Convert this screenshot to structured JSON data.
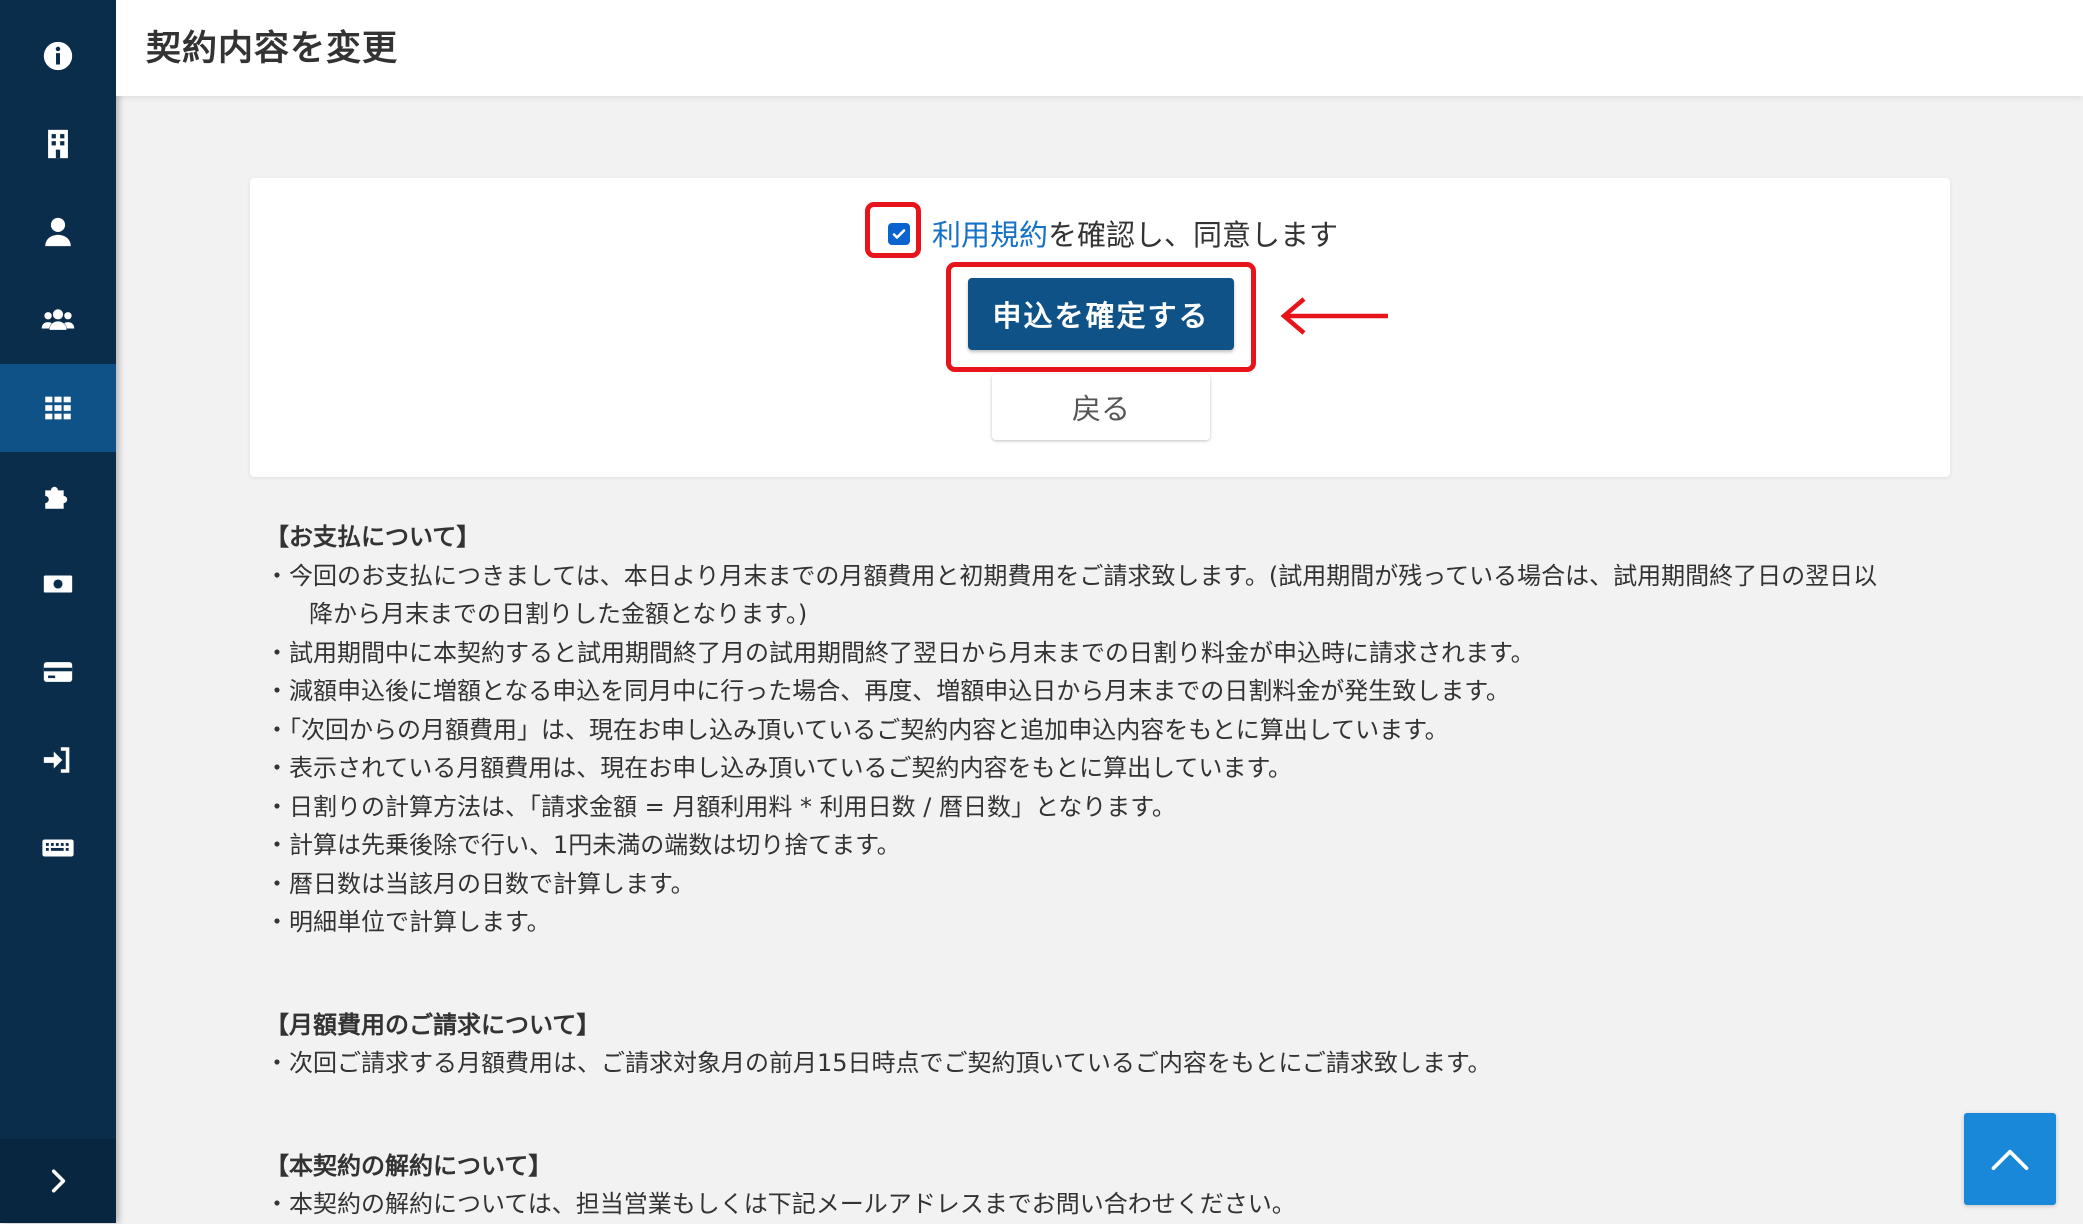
{
  "page": {
    "title": "契約内容を変更"
  },
  "sidebar": {
    "items": [
      {
        "icon": "info-icon"
      },
      {
        "icon": "building-icon"
      },
      {
        "icon": "user-icon"
      },
      {
        "icon": "users-icon"
      },
      {
        "icon": "grid-icon",
        "active": true
      },
      {
        "icon": "puzzle-icon"
      },
      {
        "icon": "money-icon"
      },
      {
        "icon": "credit-card-icon"
      },
      {
        "icon": "sign-in-icon"
      },
      {
        "icon": "keyboard-icon"
      }
    ],
    "toggle_icon": "chevron-right-icon"
  },
  "agreement": {
    "checked": true,
    "terms_link": "利用規約",
    "text": "を確認し、同意します"
  },
  "buttons": {
    "confirm": "申込を確定する",
    "back": "戻る"
  },
  "notes": {
    "payment_title": "【お支払について】",
    "payment_lines": [
      "・今回のお支払につきましては、本日より月末までの月額費用と初期費用をご請求致します。(試用期間が残っている場合は、試用期間終了日の翌日以",
      "降から月末までの日割りした金額となります。)",
      "・試用期間中に本契約すると試用期間終了月の試用期間終了翌日から月末までの日割り料金が申込時に請求されます。",
      "・減額申込後に増額となる申込を同月中に行った場合、再度、増額申込日から月末までの日割料金が発生致します。",
      "・「次回からの月額費用」は、現在お申し込み頂いているご契約内容と追加申込内容をもとに算出しています。",
      "・表示されている月額費用は、現在お申し込み頂いているご契約内容をもとに算出しています。",
      "・日割りの計算方法は、「請求金額 = 月額利用料 * 利用日数 / 暦日数」となります。",
      "・計算は先乗後除で行い、1円未満の端数は切り捨てます。",
      "・暦日数は当該月の日数で計算します。",
      "・明細単位で計算します。"
    ],
    "monthly_title": "【月額費用のご請求について】",
    "monthly_lines": [
      "・次回ご請求する月額費用は、ご請求対象月の前月15日時点でご契約頂いているご内容をもとにご請求致します。"
    ],
    "cancel_title": "【本契約の解約について】",
    "cancel_lines": [
      "・本契約の解約については、担当営業もしくは下記メールアドレスまでお問い合わせください。"
    ]
  },
  "colors": {
    "sidebar_bg": "#0b2d4c",
    "sidebar_active": "#0e5287",
    "primary_button": "#0e5287",
    "highlight": "#e8141b",
    "link": "#1672c7",
    "scroll_top": "#1a88d8"
  },
  "scroll_top_icon": "chevron-up-icon"
}
